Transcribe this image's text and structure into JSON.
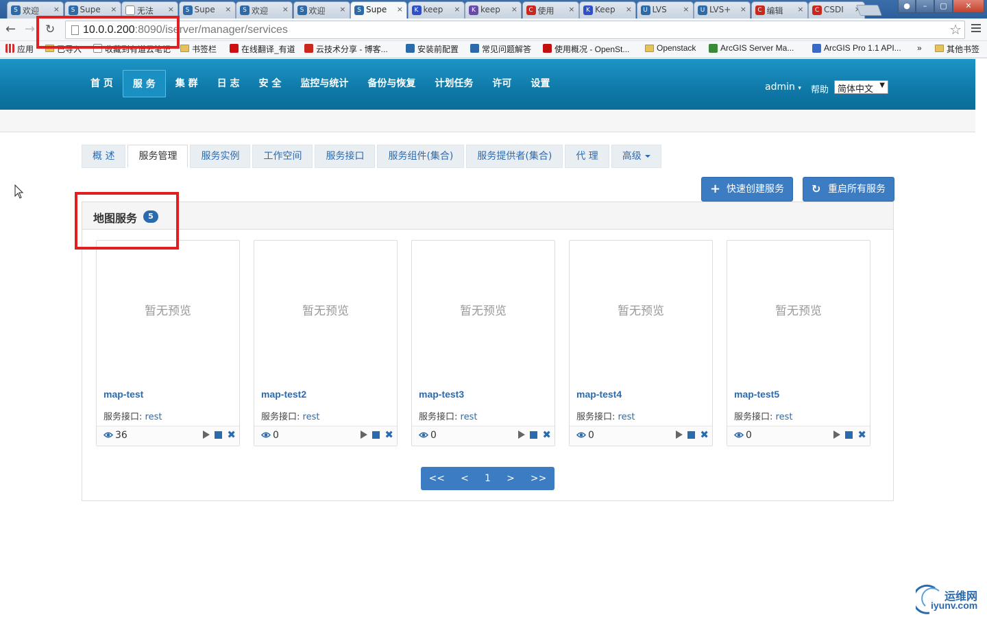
{
  "browser": {
    "tabs": [
      {
        "label": "欢迎",
        "color": "#2d6aa8",
        "glyph": "S"
      },
      {
        "label": "Supe",
        "color": "#2d6aa8",
        "glyph": "S"
      },
      {
        "label": "无法",
        "color": "#ffffff",
        "glyph": ""
      },
      {
        "label": "Supe",
        "color": "#2d6aa8",
        "glyph": "S"
      },
      {
        "label": "欢迎",
        "color": "#2d6aa8",
        "glyph": "S"
      },
      {
        "label": "欢迎",
        "color": "#2d6aa8",
        "glyph": "S"
      },
      {
        "label": "Supe",
        "color": "#2d6aa8",
        "glyph": "S",
        "active": true
      },
      {
        "label": "keep",
        "color": "#3050c8",
        "glyph": "K"
      },
      {
        "label": "keep",
        "color": "#6a4aa8",
        "glyph": "K"
      },
      {
        "label": "使用",
        "color": "#c8281e",
        "glyph": "C"
      },
      {
        "label": "Keep",
        "color": "#3050c8",
        "glyph": "K"
      },
      {
        "label": "LVS",
        "color": "#2d6aa8",
        "glyph": "U"
      },
      {
        "label": "LVS+",
        "color": "#2d6aa8",
        "glyph": "U"
      },
      {
        "label": "编辑",
        "color": "#c8281e",
        "glyph": "C"
      },
      {
        "label": "CSDI",
        "color": "#c8281e",
        "glyph": "C"
      }
    ],
    "close_glyph": "×",
    "url_host": "10.0.0.200",
    "url_rest": ":8090/iserver/manager/services",
    "bookmarks": [
      {
        "label": "应用",
        "icon": "apps-icon",
        "color": "#d03030"
      },
      {
        "label": "已导入",
        "icon": "folder-icon",
        "color": "#e6c25a"
      },
      {
        "label": "收藏到有道云笔记",
        "icon": "page-icon",
        "color": "#ffffff"
      },
      {
        "label": "书签栏",
        "icon": "folder-icon",
        "color": "#e6c25a"
      },
      {
        "label": "在线翻译_有道",
        "icon": "youdao-icon",
        "color": "#d01010"
      },
      {
        "label": "云技术分享 - 博客...",
        "icon": "csdn-icon",
        "color": "#c8281e"
      },
      {
        "label": "安装前配置",
        "icon": "supermap-icon",
        "color": "#2d6aa8"
      },
      {
        "label": "常见问题解答",
        "icon": "supermap-icon",
        "color": "#2d6aa8"
      },
      {
        "label": "使用概况 - OpenSt...",
        "icon": "openstack-icon",
        "color": "#c01010"
      },
      {
        "label": "Openstack",
        "icon": "folder-icon",
        "color": "#e6c25a"
      },
      {
        "label": "ArcGIS Server Ma...",
        "icon": "arcgis-icon",
        "color": "#3a8a3a"
      },
      {
        "label": "ArcGIS Pro 1.1 API...",
        "icon": "arcgis-pro-icon",
        "color": "#3a6ac8"
      },
      {
        "label": "其他书签",
        "icon": "folder-icon",
        "color": "#e6c25a"
      }
    ],
    "more_glyph": "»"
  },
  "app": {
    "nav": [
      "首 页",
      "服 务",
      "集 群",
      "日 志",
      "安 全",
      "监控与统计",
      "备份与恢复",
      "计划任务",
      "许可",
      "设置"
    ],
    "active_nav_index": 1,
    "user": "admin",
    "help": "帮助",
    "language": "简体中文"
  },
  "page": {
    "tabs": [
      "概 述",
      "服务管理",
      "服务实例",
      "工作空间",
      "服务接口",
      "服务组件(集合)",
      "服务提供者(集合)",
      "代 理",
      "高级"
    ],
    "active_tab_index": 1,
    "create_button": "快速创建服务",
    "restart_button": "重启所有服务",
    "panel_title": "地图服务",
    "panel_count": "5",
    "no_preview": "暂无预览",
    "interface_label": "服务接口: ",
    "services": [
      {
        "name": "map-test",
        "interface": "rest",
        "views": "36"
      },
      {
        "name": "map-test2",
        "interface": "rest",
        "views": "0"
      },
      {
        "name": "map-test3",
        "interface": "rest",
        "views": "0"
      },
      {
        "name": "map-test4",
        "interface": "rest",
        "views": "0"
      },
      {
        "name": "map-test5",
        "interface": "rest",
        "views": "0"
      }
    ],
    "pager": [
      "<<",
      "<",
      "1",
      ">",
      ">>"
    ]
  },
  "watermark": {
    "line1": "运维网",
    "line2": "iyunv.com"
  },
  "colors": {
    "accent": "#2a6bb0",
    "header_top": "#1c95c6",
    "annotation": "#e02020"
  }
}
